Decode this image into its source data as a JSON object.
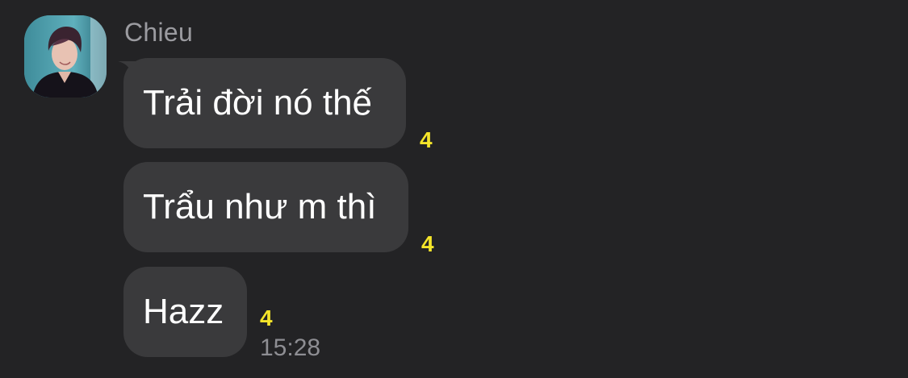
{
  "sender": {
    "name": "Chieu",
    "avatar_icon": "profile-photo"
  },
  "messages": [
    {
      "text": "Trải đời nó thế",
      "unread_count": "4"
    },
    {
      "text": "Trẩu như m thì",
      "unread_count": "4"
    },
    {
      "text": "Hazz",
      "unread_count": "4"
    }
  ],
  "timestamp": "15:28",
  "colors": {
    "background": "#232325",
    "bubble": "#3a3a3c",
    "unread_count": "#f5e52a",
    "secondary_text": "#8e8e93"
  }
}
